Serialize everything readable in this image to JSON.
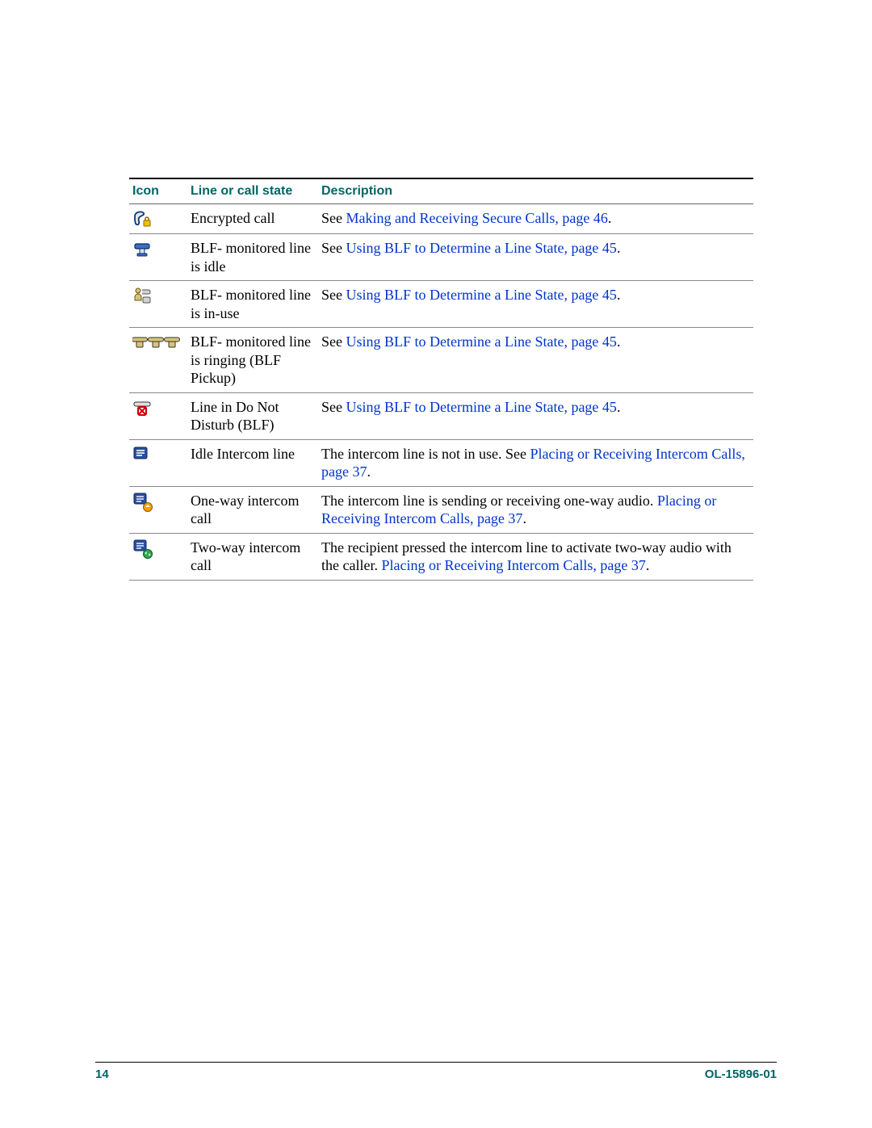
{
  "columns": {
    "icon": "Icon",
    "state": "Line or call state",
    "desc": "Description"
  },
  "rows": [
    {
      "state": "Encrypted call",
      "desc_pre": "See ",
      "link1": "Making and Receiving Secure Calls, page 46",
      "desc_post": "."
    },
    {
      "state": "BLF- monitored line is idle",
      "desc_pre": "See ",
      "link1": "Using BLF to Determine a Line State, page 45",
      "desc_post": "."
    },
    {
      "state": "BLF- monitored line is in-use",
      "desc_pre": "See ",
      "link1": "Using BLF to Determine a Line State, page 45",
      "desc_post": "."
    },
    {
      "state": "BLF- monitored line is ringing (BLF Pickup)",
      "desc_pre": "See ",
      "link1": "Using BLF to Determine a Line State, page 45",
      "desc_post": "."
    },
    {
      "state": "Line in Do Not Disturb (BLF)",
      "desc_pre": "See ",
      "link1": "Using BLF to Determine a Line State, page 45",
      "desc_post": "."
    },
    {
      "state": "Idle Intercom line",
      "desc_pre": "The intercom line is not in use. See ",
      "link1": "Placing or Receiving Intercom Calls, page 37",
      "desc_post": "."
    },
    {
      "state": "One-way intercom call",
      "desc_pre": "The intercom line is sending or receiving one-way audio. ",
      "link1": "Placing or Receiving Intercom Calls, page 37",
      "desc_post": "."
    },
    {
      "state": "Two-way intercom call",
      "desc_pre": "The recipient pressed the intercom line to activate two-way audio with the caller. ",
      "link1": "Placing or Receiving Intercom Calls, page 37",
      "desc_post": "."
    }
  ],
  "footer": {
    "page": "14",
    "doc": "OL-15896-01"
  }
}
